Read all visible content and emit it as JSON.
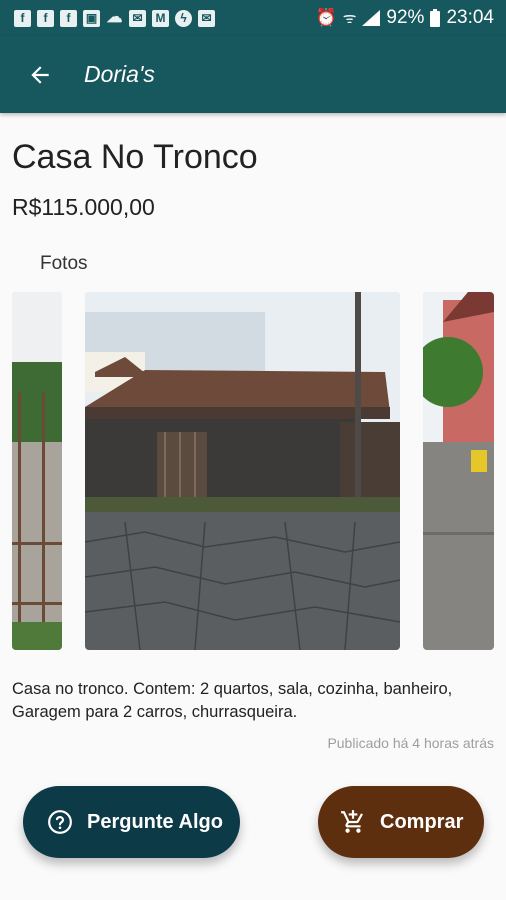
{
  "status_bar": {
    "notifications": [
      "facebook-icon",
      "facebook-icon",
      "facebook-icon",
      "image-icon",
      "cloud-icon",
      "email-icon",
      "gmail-icon",
      "messenger-icon",
      "email-icon"
    ],
    "battery": "92%",
    "time": "23:04"
  },
  "appbar": {
    "title": "Doria's"
  },
  "listing": {
    "title": "Casa No Tronco",
    "price": "R$115.000,00",
    "photos_label": "Fotos",
    "description": "Casa no tronco. Contem: 2 quartos, sala, cozinha, banheiro, Garagem para 2 carros, churrasqueira.",
    "published": "Publicado há 4 horas atrás"
  },
  "actions": {
    "ask": "Pergunte Algo",
    "buy": "Comprar"
  },
  "colors": {
    "primary": "#17575e",
    "ask_button": "#0c3a47",
    "buy_button": "#5d2f0f"
  }
}
